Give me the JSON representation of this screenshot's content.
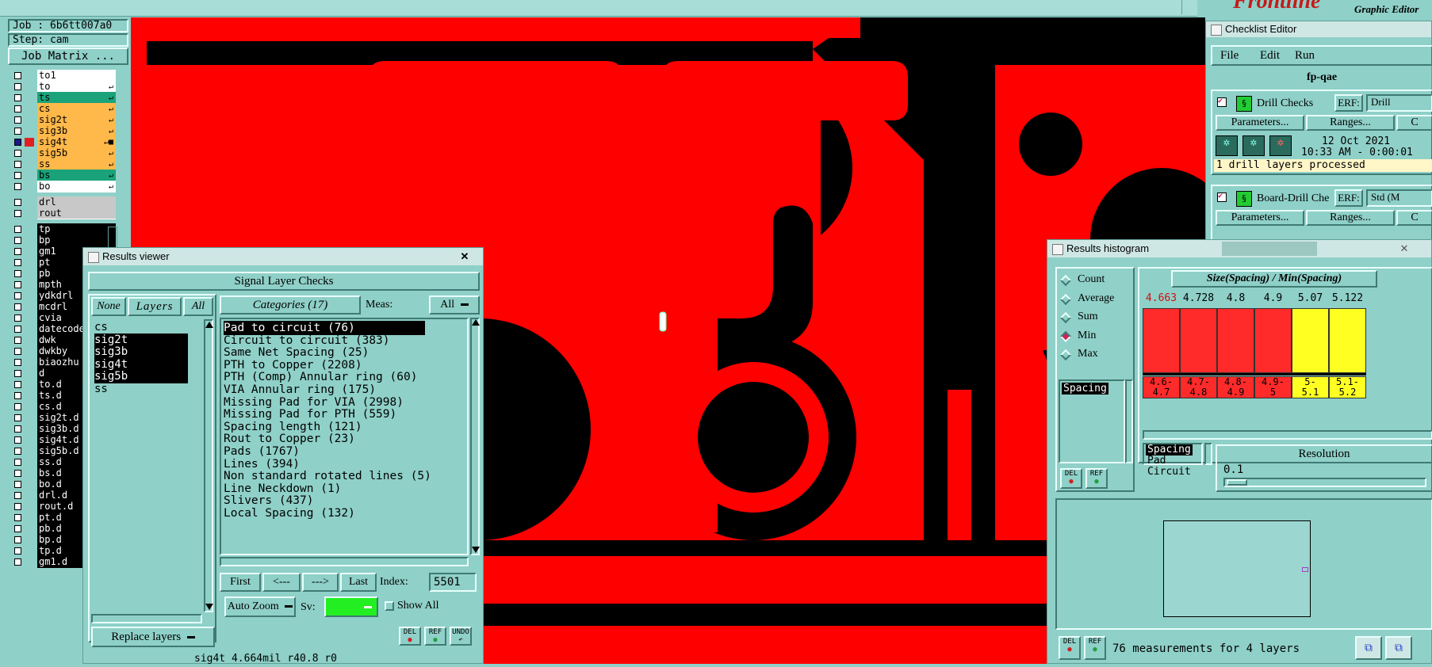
{
  "app": {
    "brand": "Frontline",
    "subtitle": "Graphic Editor",
    "job": "Job : 6b6tt007a0",
    "step": "Step: cam",
    "job_matrix": "Job Matrix ...",
    "status_line": "sig4t 4.664mil  r40.8  r0"
  },
  "layers": [
    {
      "name": "to1",
      "color": "#ffffff",
      "marker": "",
      "checked": false
    },
    {
      "name": "to",
      "color": "#ffffff",
      "marker": "↵",
      "checked": false
    },
    {
      "name": "ts",
      "color": "#1aa37a",
      "marker": "↵",
      "checked": false
    },
    {
      "name": "cs",
      "color": "#ffb84a",
      "marker": "↵",
      "checked": false
    },
    {
      "name": "sig2t",
      "color": "#ffb84a",
      "marker": "↵",
      "checked": false
    },
    {
      "name": "sig3b",
      "color": "#ffb84a",
      "marker": "↵",
      "checked": false
    },
    {
      "name": "sig4t",
      "color": "#ffb84a",
      "marker": "↵■",
      "checked": true
    },
    {
      "name": "sig5b",
      "color": "#ffb84a",
      "marker": "↵",
      "checked": false
    },
    {
      "name": "ss",
      "color": "#ffb84a",
      "marker": "↵",
      "checked": false
    },
    {
      "name": "bs",
      "color": "#1aa37a",
      "marker": "↵",
      "checked": false
    },
    {
      "name": "bo",
      "color": "#ffffff",
      "marker": "↵",
      "checked": false
    }
  ],
  "drill_layers": [
    {
      "name": "drl",
      "color": "#c8c8c8"
    },
    {
      "name": "rout",
      "color": "#c8c8c8"
    }
  ],
  "misc_layers": [
    "tp",
    "bp",
    "gm1",
    "pt",
    "pb",
    "mpth",
    "ydkdrl",
    "mcdrl",
    "cvia",
    "datecode",
    "dwk",
    "dwkby",
    "biaozhu",
    "d",
    "to.d",
    "ts.d",
    "cs.d",
    "sig2t.d",
    "sig3b.d",
    "sig4t.d",
    "sig5b.d",
    "ss.d",
    "bs.d",
    "bo.d",
    "drl.d",
    "rout.d",
    "pt.d",
    "pb.d",
    "bp.d",
    "tp.d",
    "gm1.d"
  ],
  "results_viewer": {
    "title": "Results viewer",
    "close": "✕",
    "header": "Signal Layer Checks",
    "btn_none": "None",
    "btn_layers": "Layers",
    "btn_all": "All",
    "categories_label": "Categories (17)",
    "meas_label": "Meas:",
    "meas_value": "All",
    "layer_list": [
      {
        "name": "cs",
        "selected": false
      },
      {
        "name": "sig2t",
        "selected": true
      },
      {
        "name": "sig3b",
        "selected": true
      },
      {
        "name": "sig4t",
        "selected": true
      },
      {
        "name": "sig5b",
        "selected": true
      },
      {
        "name": "ss",
        "selected": false
      }
    ],
    "categories": [
      {
        "label": "Pad to circuit (76)",
        "selected": true
      },
      {
        "label": "Circuit to circuit (383)",
        "selected": false
      },
      {
        "label": "Same Net Spacing (25)",
        "selected": false
      },
      {
        "label": "PTH to Copper (2208)",
        "selected": false
      },
      {
        "label": "PTH (Comp) Annular ring (60)",
        "selected": false
      },
      {
        "label": "VIA Annular ring (175)",
        "selected": false
      },
      {
        "label": "Missing Pad for VIA (2998)",
        "selected": false
      },
      {
        "label": "Missing Pad for PTH (559)",
        "selected": false
      },
      {
        "label": "Spacing length (121)",
        "selected": false
      },
      {
        "label": "Rout to Copper (23)",
        "selected": false
      },
      {
        "label": "Pads (1767)",
        "selected": false
      },
      {
        "label": "Lines (394)",
        "selected": false
      },
      {
        "label": "Non standard rotated lines (5)",
        "selected": false
      },
      {
        "label": "Line Neckdown (1)",
        "selected": false
      },
      {
        "label": "Slivers (437)",
        "selected": false
      },
      {
        "label": "Local Spacing (132)",
        "selected": false
      }
    ],
    "nav_first": "First",
    "nav_prev": "<---",
    "nav_next": "--->",
    "nav_last": "Last",
    "index_label": "Index:",
    "index_value": "5501",
    "auto_zoom": "Auto Zoom",
    "sv_label": "Sv:",
    "show_all": "Show All",
    "replace_layers": "Replace layers",
    "del": "DEL",
    "ref": "REF",
    "undo": "UNDO"
  },
  "checklist_editor": {
    "title": "Checklist Editor",
    "menu": [
      "File",
      "Edit",
      "Run"
    ],
    "checklist_name": "fp-qae",
    "check1_name": "Drill Checks",
    "check2_name": "Board-Drill Che",
    "erf_label": "ERF:",
    "erf1_value": "Drill",
    "erf2_value": "Std (M",
    "parameters": "Parameters...",
    "ranges": "Ranges...",
    "date": "12 Oct 2021",
    "time": "10:33 AM - 0:00:01",
    "status": "1 drill layers processed"
  },
  "histogram": {
    "title": "Results histogram",
    "stat_options": [
      {
        "label": "Count",
        "on": false
      },
      {
        "label": "Average",
        "on": false
      },
      {
        "label": "Sum",
        "on": false
      },
      {
        "label": "Min",
        "on": true
      },
      {
        "label": "Max",
        "on": false
      }
    ],
    "measure_list": [
      "Spacing"
    ],
    "chart_title": "Size(Spacing) / Min(Spacing)",
    "resolution_label": "Resolution",
    "resolution_value": "0.1",
    "type_list": [
      {
        "label": "Spacing",
        "selected": true
      },
      {
        "label": "Pad",
        "selected": false
      },
      {
        "label": "Circuit",
        "selected": false
      }
    ],
    "footer": "76 measurements for 4 layers",
    "del": "DEL",
    "ref": "REF",
    "chart_data": {
      "type": "bar",
      "categories": [
        "4.6-4.7",
        "4.7-4.8",
        "4.8-4.9",
        "4.9-5",
        "5-5.1",
        "5.1-5.2"
      ],
      "values": [
        4.663,
        4.728,
        4.8,
        4.9,
        5.07,
        5.122
      ],
      "value_labels": [
        "4.663",
        "4.728",
        "4.8",
        "4.9",
        "5.07",
        "5.122"
      ],
      "range_lines": [
        [
          "4.6-",
          "4.7"
        ],
        [
          "4.7-",
          "4.8"
        ],
        [
          "4.8-",
          "4.9"
        ],
        [
          "4.9-",
          "5"
        ],
        [
          "5-",
          "5.1"
        ],
        [
          "5.1-",
          "5.2"
        ]
      ],
      "colors": [
        "#ff2a2a",
        "#ff2a2a",
        "#ff2a2a",
        "#ff2a2a",
        "#ffff22",
        "#ffff22"
      ],
      "highlight_label_color": "#d01010",
      "title": "Size(Spacing) / Min(Spacing)"
    }
  }
}
